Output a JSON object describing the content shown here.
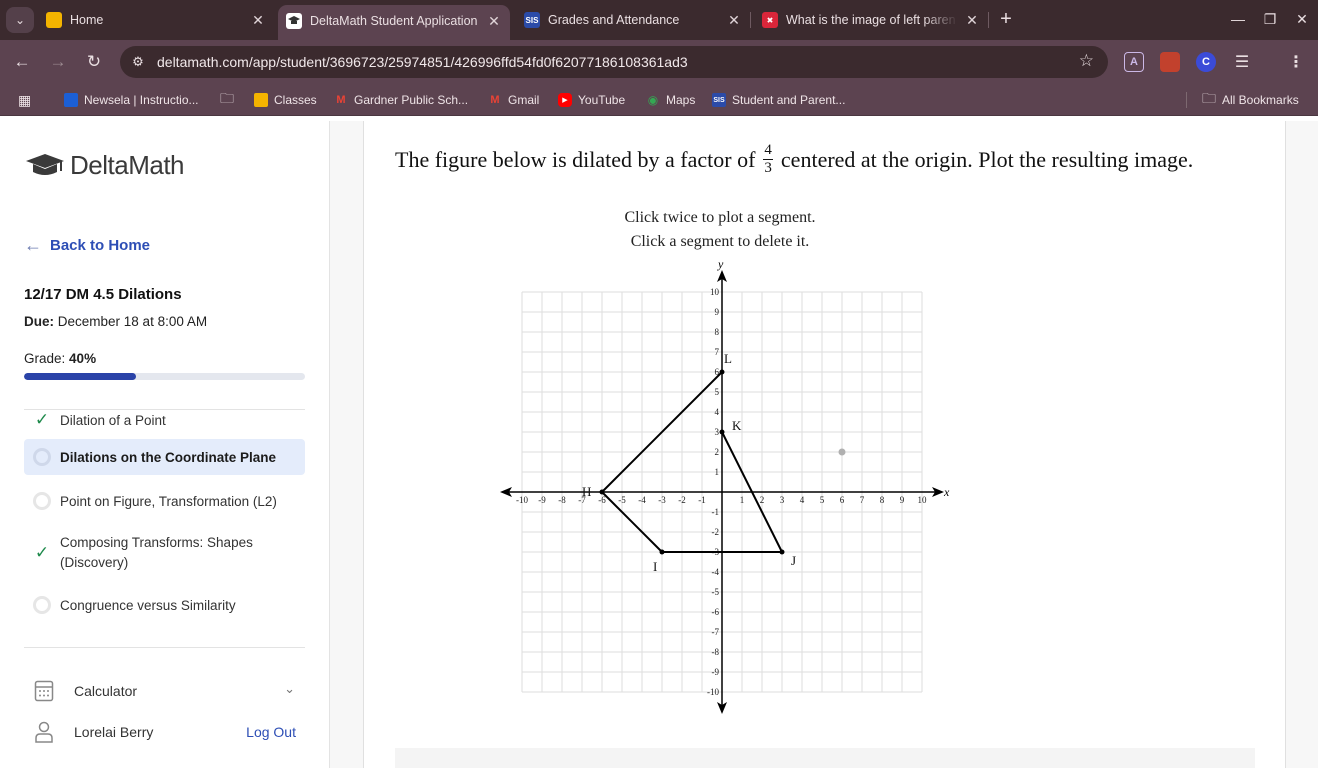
{
  "browser": {
    "tabs": [
      {
        "title": "Home",
        "favicon": "classroom-icon",
        "color": "#f4b400",
        "active": false
      },
      {
        "title": "DeltaMath Student Application",
        "favicon": "deltamath-icon",
        "color": "#ffffff",
        "active": true
      },
      {
        "title": "Grades and Attendance",
        "favicon": "sis-icon",
        "color": "#2b4ba8",
        "active": false
      },
      {
        "title": "What is the image of left paren",
        "favicon": "x-icon",
        "color": "#d9263a",
        "active": false
      }
    ],
    "url": "deltamath.com/app/student/3696723/25974851/426996ffd54fd0f62077186108361ad3",
    "bookmarks": [
      {
        "label": "Newsela | Instructio...",
        "icon": "newsela-icon"
      },
      {
        "label": "",
        "icon": "folder-icon"
      },
      {
        "label": "Classes",
        "icon": "classroom-icon"
      },
      {
        "label": "Gardner Public Sch...",
        "icon": "gmail-icon"
      },
      {
        "label": "Gmail",
        "icon": "gmail-icon"
      },
      {
        "label": "YouTube",
        "icon": "youtube-icon"
      },
      {
        "label": "Maps",
        "icon": "maps-icon"
      },
      {
        "label": "Student and Parent...",
        "icon": "sis-icon"
      }
    ],
    "all_bookmarks": "All Bookmarks"
  },
  "sidebar": {
    "logo_text": "DeltaMath",
    "back_label": "Back to Home",
    "assignment_title": "12/17 DM 4.5 Dilations",
    "due_label": "Due:",
    "due_value": "December 18 at 8:00 AM",
    "grade_label": "Grade:",
    "grade_value": "40%",
    "grade_fraction": 0.4,
    "problems": [
      {
        "label": "Dilation of a Point",
        "status": "complete"
      },
      {
        "label": "Dilations on the Coordinate Plane",
        "status": "active"
      },
      {
        "label": "Point on Figure, Transformation (L2)",
        "status": "incomplete"
      },
      {
        "label": "Composing Transforms: Shapes (Discovery)",
        "status": "complete"
      },
      {
        "label": "Congruence versus Similarity",
        "status": "incomplete"
      }
    ],
    "calculator_label": "Calculator",
    "user_name": "Lorelai Berry",
    "logout_label": "Log Out"
  },
  "question": {
    "text_before": "The figure below is dilated by a factor of",
    "factor_num": "4",
    "factor_den": "3",
    "text_after": "centered at the origin. Plot the resulting image.",
    "instruction_1": "Click twice to plot a segment.",
    "instruction_2": "Click a segment to delete it."
  },
  "graph": {
    "x_range": [
      -10,
      10
    ],
    "y_range": [
      -10,
      10
    ],
    "x_axis_label": "x",
    "y_axis_label": "y",
    "points": [
      {
        "label": "H",
        "x": -6,
        "y": 0
      },
      {
        "label": "I",
        "x": -3,
        "y": -3
      },
      {
        "label": "J",
        "x": 3,
        "y": -3
      },
      {
        "label": "K",
        "x": 0,
        "y": 3
      },
      {
        "label": "L",
        "x": 0,
        "y": 6
      }
    ],
    "segments": [
      [
        "H",
        "I"
      ],
      [
        "I",
        "J"
      ],
      [
        "J",
        "K"
      ],
      [
        "H",
        "L"
      ]
    ],
    "cursor_point": {
      "x": 6,
      "y": 2
    },
    "colors": {
      "grid": "#dddddd",
      "axis": "#000000",
      "figure": "#000000",
      "cursor": "#b0b0b0"
    }
  },
  "colors": {
    "accent": "#2d4eb5",
    "progress": "#2a43a8",
    "active_item": "#e4ecfb",
    "check": "#1f8a4c"
  }
}
